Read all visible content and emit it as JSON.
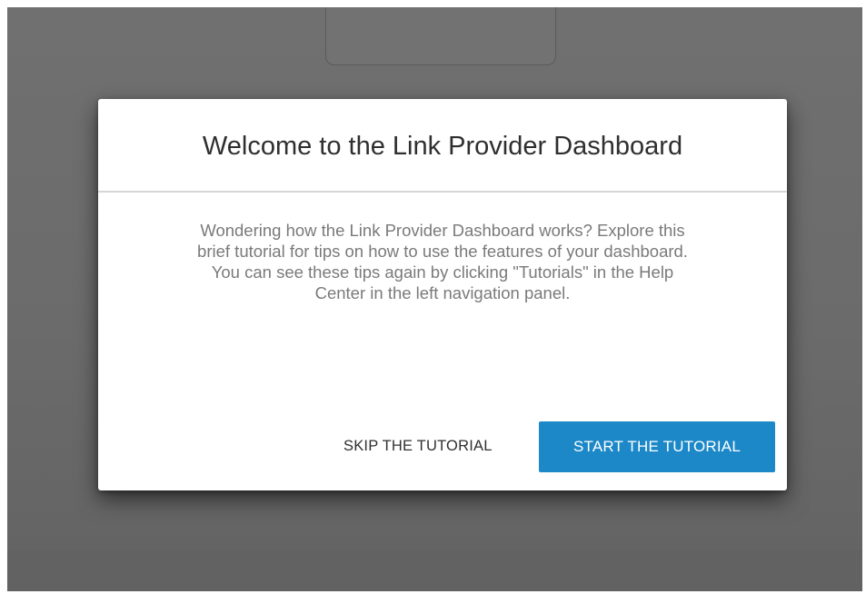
{
  "modal": {
    "title": "Welcome to the Link Provider Dashboard",
    "body_lines": [
      "Wondering how the Link Provider Dashboard works? Explore this",
      "brief tutorial for tips on how to use the features of your dashboard.",
      "You can see these tips again by clicking \"Tutorials\" in the Help",
      "Center in the left navigation panel."
    ],
    "skip_label": "SKIP THE TUTORIAL",
    "start_label": "START THE TUTORIAL"
  },
  "colors": {
    "overlay": "#6b6b6b",
    "primary_button": "#1c88c8",
    "title_text": "#2f2f2f",
    "body_text": "#7a7a7a"
  }
}
